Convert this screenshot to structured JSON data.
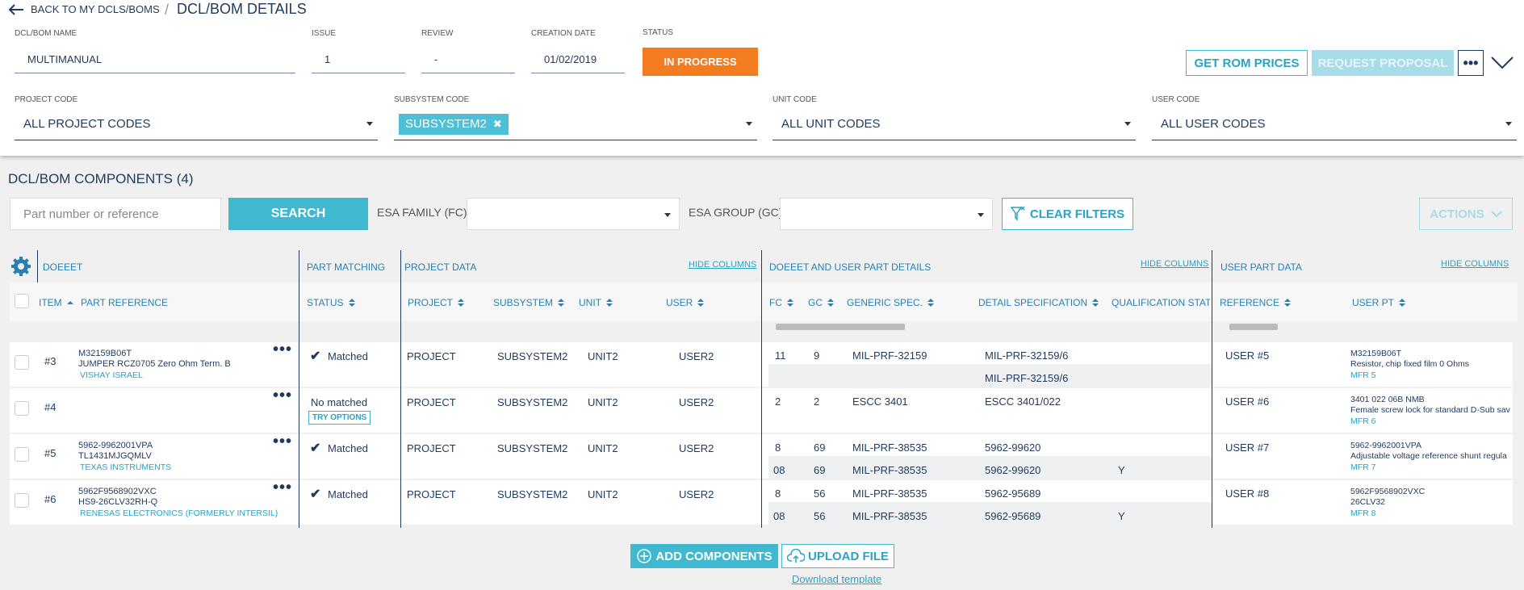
{
  "header": {
    "back_label": "BACK TO MY DCLS/BOMS",
    "separator": "/",
    "title": "DCL/BOM DETAILS",
    "name_label": "DCL/BOM NAME",
    "name_value": "MULTIMANUAL",
    "issue_label": "ISSUE",
    "issue_value": "1",
    "review_label": "REVIEW",
    "review_value": "-",
    "creation_label": "CREATION DATE",
    "creation_value": "01/02/2019",
    "status_label": "STATUS",
    "status_value": "IN PROGRESS",
    "get_rom": "GET ROM PRICES",
    "request_proposal": "REQUEST PROPOSAL"
  },
  "filters": {
    "project_label": "PROJECT CODE",
    "project_value": "ALL PROJECT CODES",
    "subsystem_label": "SUBSYSTEM CODE",
    "subsystem_chip": "SUBSYSTEM2",
    "unit_label": "UNIT CODE",
    "unit_value": "ALL UNIT CODES",
    "user_label": "USER CODE",
    "user_value": "ALL USER CODES"
  },
  "components": {
    "title": "DCL/BOM COMPONENTS (4)",
    "search_placeholder": "Part number or reference",
    "search_button": "SEARCH",
    "esa_family_label": "ESA FAMILY (FC)",
    "esa_group_label": "ESA GROUP (GC)",
    "clear_filters": "CLEAR FILTERS",
    "actions": "ACTIONS"
  },
  "groups": {
    "doeeet": "DOEEET",
    "part_matching": "PART MATCHING",
    "project_data": "PROJECT DATA",
    "doeeet_user": "DOEEET AND USER PART DETAILS",
    "user_part": "USER PART DATA",
    "hide": "HIDE COLUMNS"
  },
  "columns": {
    "item": "ITEM",
    "part_ref": "PART REFERENCE",
    "status": "STATUS",
    "project": "PROJECT",
    "subsystem": "SUBSYSTEM",
    "unit": "UNIT",
    "user": "USER",
    "fc": "FC",
    "gc": "GC",
    "generic": "GENERIC SPEC.",
    "detail": "DETAIL SPECIFICATION",
    "qual": "QUALIFICATION STATUS",
    "reference": "REFERENCE",
    "user_pt": "USER PT"
  },
  "rows": [
    {
      "item": "#3",
      "pn": "M32159B06T",
      "desc": "JUMPER RCZ0705 Zero Ohm Term. B",
      "mfr": "VISHAY ISRAEL",
      "status": "Matched",
      "project": "PROJECT",
      "subsystem": "SUBSYSTEM2",
      "unit": "UNIT2",
      "user": "USER2",
      "fc": "11",
      "gc": "9",
      "generic": "MIL-PRF-32159",
      "detail": "MIL-PRF-32159/6",
      "qual": "",
      "sub": {
        "fc": "",
        "gc": "",
        "generic": "",
        "detail": "MIL-PRF-32159/6",
        "qual": ""
      },
      "ref": "USER #5",
      "upt1": "M32159B06T",
      "upt2": "Resistor, chip fixed film 0 Ohms",
      "umfr": "MFR 5"
    },
    {
      "item": "#4",
      "pn": "",
      "desc": "",
      "mfr": "",
      "status": "No matched",
      "try": "TRY OPTIONS",
      "project": "PROJECT",
      "subsystem": "SUBSYSTEM2",
      "unit": "UNIT2",
      "user": "USER2",
      "fc": "2",
      "gc": "2",
      "generic": "ESCC 3401",
      "detail": "ESCC 3401/022",
      "qual": "",
      "ref": "USER #6",
      "upt1": "3401 022 06B NMB",
      "upt2": "Female screw lock for standard D-Sub sav",
      "umfr": "MFR 6"
    },
    {
      "item": "#5",
      "pn": "5962-9962001VPA",
      "desc": "TL1431MJGQMLV",
      "mfr": "TEXAS INSTRUMENTS",
      "status": "Matched",
      "project": "PROJECT",
      "subsystem": "SUBSYSTEM2",
      "unit": "UNIT2",
      "user": "USER2",
      "fc": "8",
      "gc": "69",
      "generic": "MIL-PRF-38535",
      "detail": "5962-99620",
      "qual": "",
      "sub": {
        "fc": "08",
        "gc": "69",
        "generic": "MIL-PRF-38535",
        "detail": "5962-99620",
        "qual": "Y"
      },
      "ref": "USER #7",
      "upt1": "5962-9962001VPA",
      "upt2": "Adjustable voltage reference shunt regula",
      "umfr": "MFR 7"
    },
    {
      "item": "#6",
      "pn": "5962F9568902VXC",
      "desc": "HS9-26CLV32RH-Q",
      "mfr": "RENESAS ELECTRONICS (FORMERLY INTERSIL)",
      "status": "Matched",
      "project": "PROJECT",
      "subsystem": "SUBSYSTEM2",
      "unit": "UNIT2",
      "user": "USER2",
      "fc": "8",
      "gc": "56",
      "generic": "MIL-PRF-38535",
      "detail": "5962-95689",
      "qual": "",
      "sub": {
        "fc": "08",
        "gc": "56",
        "generic": "MIL-PRF-38535",
        "detail": "5962-95689",
        "qual": "Y"
      },
      "ref": "USER #8",
      "upt1": "5962F9568902VXC",
      "upt2": "26CLV32",
      "umfr": "MFR 8"
    }
  ],
  "footer": {
    "add": "ADD COMPONENTS",
    "upload": "UPLOAD FILE",
    "download": "Download template"
  },
  "colors": {
    "accent": "#3fb8d0",
    "status": "#f47c20",
    "navy": "#1e3a5c"
  }
}
